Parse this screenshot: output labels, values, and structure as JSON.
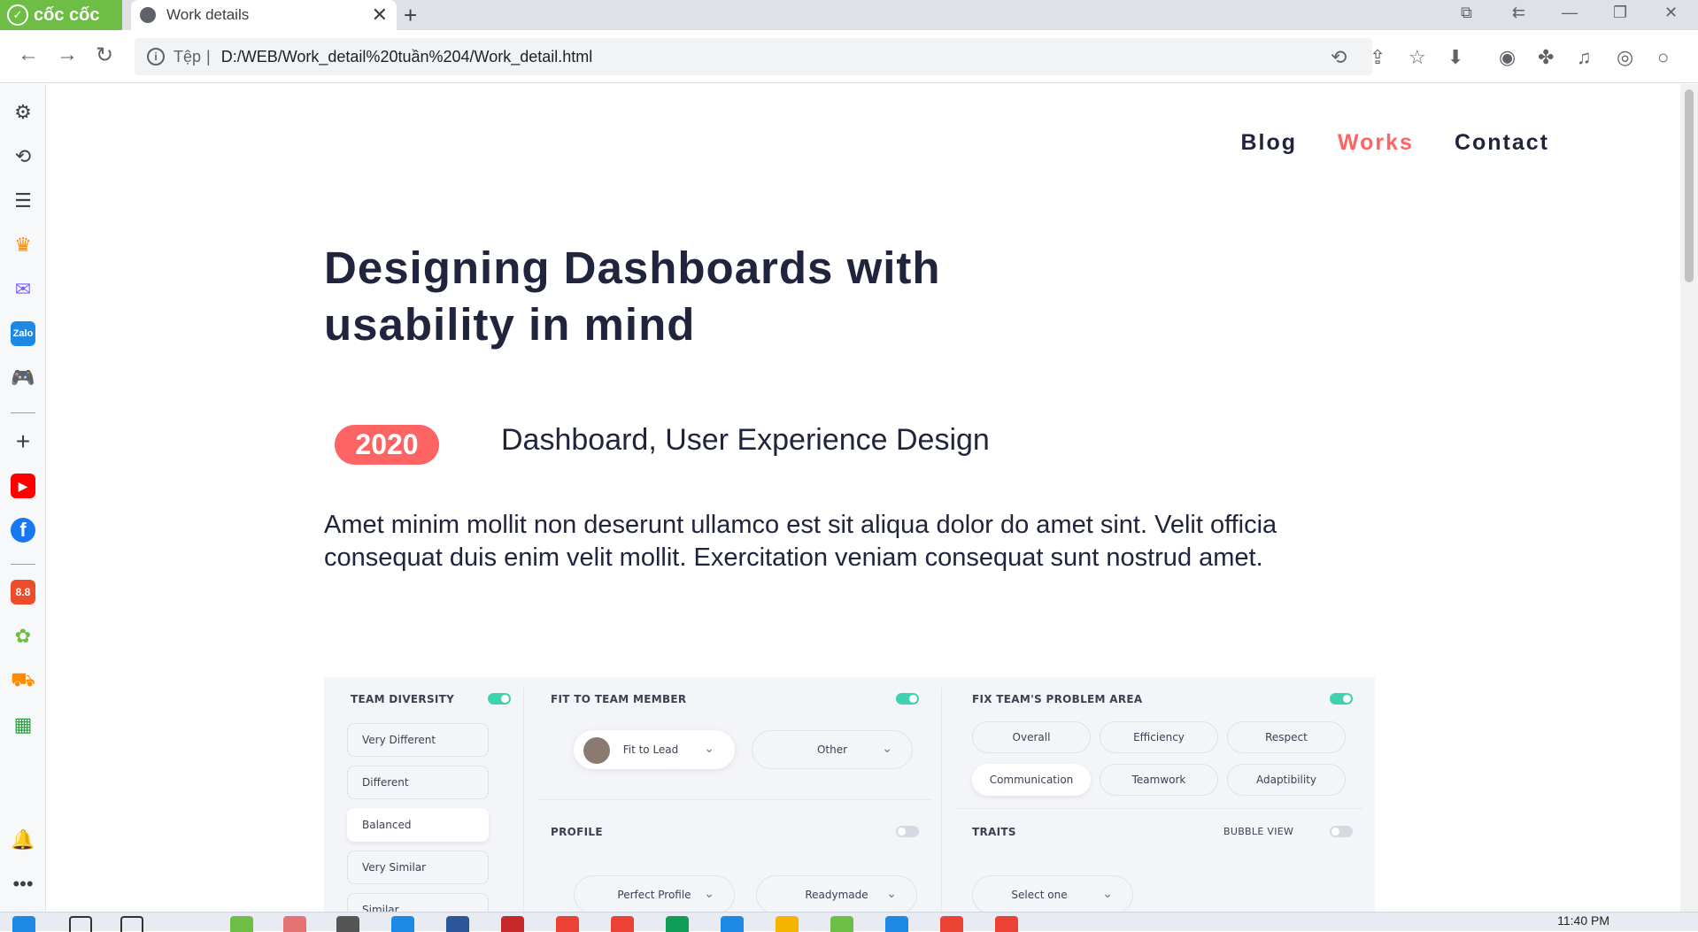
{
  "browser": {
    "brand": "cốc cốc",
    "tab_title": "Work details",
    "address_prefix": "Tệp",
    "address": "D:/WEB/Work_detail%20tuần%204/Work_detail.html"
  },
  "nav": {
    "items": [
      "Blog",
      "Works",
      "Contact"
    ],
    "active": "Works"
  },
  "work": {
    "title": "Designing Dashboards with usability in mind",
    "year": "2020",
    "category": "Dashboard, User Experience Design",
    "description": "Amet minim mollit non deserunt ullamco est sit aliqua dolor do amet sint. Velit officia consequat duis enim velit mollit. Exercitation veniam consequat sunt nostrud amet."
  },
  "dashboard": {
    "team_diversity": {
      "label": "TEAM DIVERSITY",
      "options": [
        "Very Different",
        "Different",
        "Balanced",
        "Very Similar",
        "Similar"
      ],
      "selected": "Balanced"
    },
    "fit": {
      "label": "FIT TO TEAM MEMBER",
      "dropdown1": "Fit to Lead",
      "dropdown2": "Other"
    },
    "profile": {
      "label": "PROFILE",
      "dropdown1": "Perfect Profile",
      "dropdown2": "Readymade"
    },
    "problem": {
      "label": "FIX TEAM'S PROBLEM AREA",
      "chips": [
        "Overall",
        "Efficiency",
        "Respect",
        "Communication",
        "Teamwork",
        "Adaptibility"
      ],
      "selected": "Communication"
    },
    "traits": {
      "label": "TRAITS",
      "bubble": "BUBBLE VIEW",
      "dropdown": "Select one"
    }
  },
  "taskbar": {
    "time": "11:40 PM"
  },
  "colors": {
    "accent": "#ff6464",
    "text": "#21243d",
    "toggle_on": "#3dd3b0"
  }
}
